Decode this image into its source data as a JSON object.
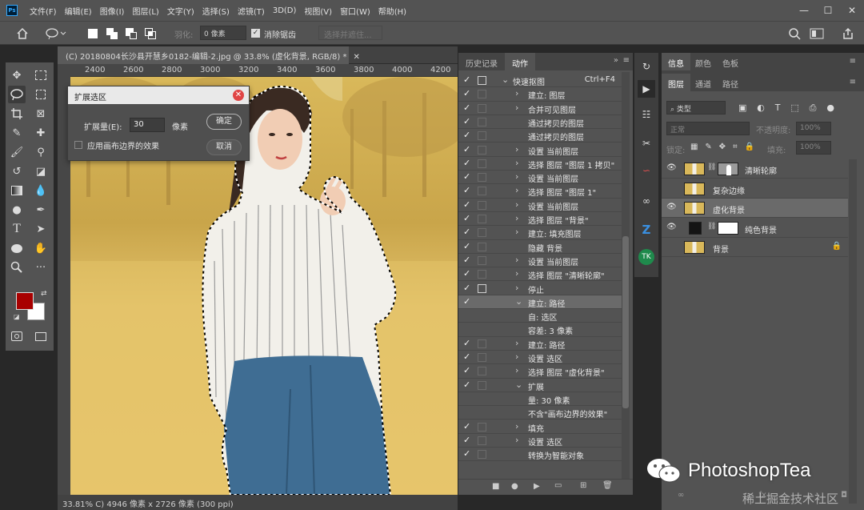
{
  "menubar": {
    "logo": "Ps",
    "items": [
      "文件(F)",
      "编辑(E)",
      "图像(I)",
      "图层(L)",
      "文字(Y)",
      "选择(S)",
      "滤镜(T)",
      "3D(D)",
      "视图(V)",
      "窗口(W)",
      "帮助(H)"
    ],
    "controls": [
      "—",
      "☐",
      "✕"
    ]
  },
  "optionsbar": {
    "feather_label": "羽化:",
    "feather_value": "0 像素",
    "antialias_label": "消除锯齿",
    "select_mask_label": "选择并遮住..."
  },
  "document": {
    "tab_title": "(C) 20180804长沙县开慧乡0182-编辑-2.jpg @ 33.8% (虚化背景, RGB/8) *",
    "ruler_ticks": [
      "2400",
      "2600",
      "2800",
      "3000",
      "3200",
      "3400",
      "3600",
      "3800",
      "4000",
      "4200"
    ],
    "status": "33.81%   C) 4946 像素 x 2726 像素 (300 ppi)"
  },
  "dialog": {
    "title": "扩展选区",
    "amount_label": "扩展量(E):",
    "amount_value": "30",
    "unit": "像素",
    "checkbox_label": "应用画布边界的效果",
    "ok": "确定",
    "cancel": "取消"
  },
  "actions_panel": {
    "tabs": [
      "历史记录",
      "动作"
    ],
    "rows": [
      {
        "text": "快速抠图",
        "shortcut": "Ctrl+F4",
        "arrow": "⌄",
        "indent": 0,
        "box": true
      },
      {
        "text": "建立: 图层",
        "arrow": "›",
        "indent": 1
      },
      {
        "text": "合并可见图层",
        "arrow": "›",
        "indent": 1
      },
      {
        "text": "通过拷贝的图层",
        "arrow": "",
        "indent": 1
      },
      {
        "text": "通过拷贝的图层",
        "arrow": "",
        "indent": 1
      },
      {
        "text": "设置 当前图层",
        "arrow": "›",
        "indent": 1
      },
      {
        "text": "选择 图层 \"图层 1 拷贝\"",
        "arrow": "›",
        "indent": 1
      },
      {
        "text": "设置 当前图层",
        "arrow": "›",
        "indent": 1
      },
      {
        "text": "选择 图层 \"图层 1\"",
        "arrow": "›",
        "indent": 1
      },
      {
        "text": "设置 当前图层",
        "arrow": "›",
        "indent": 1
      },
      {
        "text": "选择 图层 \"背景\"",
        "arrow": "›",
        "indent": 1
      },
      {
        "text": "建立: 填充图层",
        "arrow": "›",
        "indent": 1
      },
      {
        "text": "隐藏 背景",
        "arrow": "",
        "indent": 1
      },
      {
        "text": "设置 当前图层",
        "arrow": "›",
        "indent": 1
      },
      {
        "text": "选择 图层 \"清晰轮廓\"",
        "arrow": "›",
        "indent": 1
      },
      {
        "text": "停止",
        "arrow": "›",
        "indent": 1,
        "box": true
      },
      {
        "text": "建立: 路径",
        "arrow": "⌄",
        "indent": 1,
        "selected": true
      },
      {
        "text": "自: 选区",
        "arrow": "",
        "indent": 2,
        "nocheck": true
      },
      {
        "text": "容差: 3 像素",
        "arrow": "",
        "indent": 2,
        "nocheck": true
      },
      {
        "text": "建立: 路径",
        "arrow": "›",
        "indent": 1
      },
      {
        "text": "设置 选区",
        "arrow": "›",
        "indent": 1
      },
      {
        "text": "选择 图层 \"虚化背景\"",
        "arrow": "›",
        "indent": 1
      },
      {
        "text": "扩展",
        "arrow": "⌄",
        "indent": 1
      },
      {
        "text": "量: 30 像素",
        "arrow": "",
        "indent": 2,
        "nocheck": true
      },
      {
        "text": "不含\"画布边界的效果\"",
        "arrow": "",
        "indent": 2,
        "nocheck": true
      },
      {
        "text": "填充",
        "arrow": "›",
        "indent": 1
      },
      {
        "text": "设置 选区",
        "arrow": "›",
        "indent": 1
      },
      {
        "text": "转换为智能对象",
        "arrow": "",
        "indent": 1
      }
    ]
  },
  "info_tabs": [
    "信息",
    "颜色",
    "色板"
  ],
  "layers_panel": {
    "tabs": [
      "图层",
      "通道",
      "路径"
    ],
    "kind_label": "类型",
    "blend_mode": "正常",
    "opacity_label": "不透明度:",
    "opacity_value": "100%",
    "lock_label": "锁定:",
    "fill_label": "填充:",
    "fill_value": "100%",
    "layers": [
      {
        "name": "清晰轮廓",
        "visible": true,
        "mask": true,
        "thumb": "photo"
      },
      {
        "name": "复杂边缘",
        "visible": false,
        "mask": false,
        "thumb": "photo"
      },
      {
        "name": "虚化背景",
        "visible": true,
        "mask": false,
        "thumb": "photo",
        "selected": true
      },
      {
        "name": "纯色背景",
        "visible": true,
        "mask": true,
        "thumb": "black"
      },
      {
        "name": "背景",
        "visible": false,
        "mask": false,
        "thumb": "photo",
        "locked": true
      }
    ]
  },
  "watermark": {
    "text": "PhotoshopTea",
    "sub": "稀土掘金技术社区"
  },
  "colors": {
    "foreground": "#a80000",
    "background": "#ffffff",
    "panel": "#535353"
  }
}
